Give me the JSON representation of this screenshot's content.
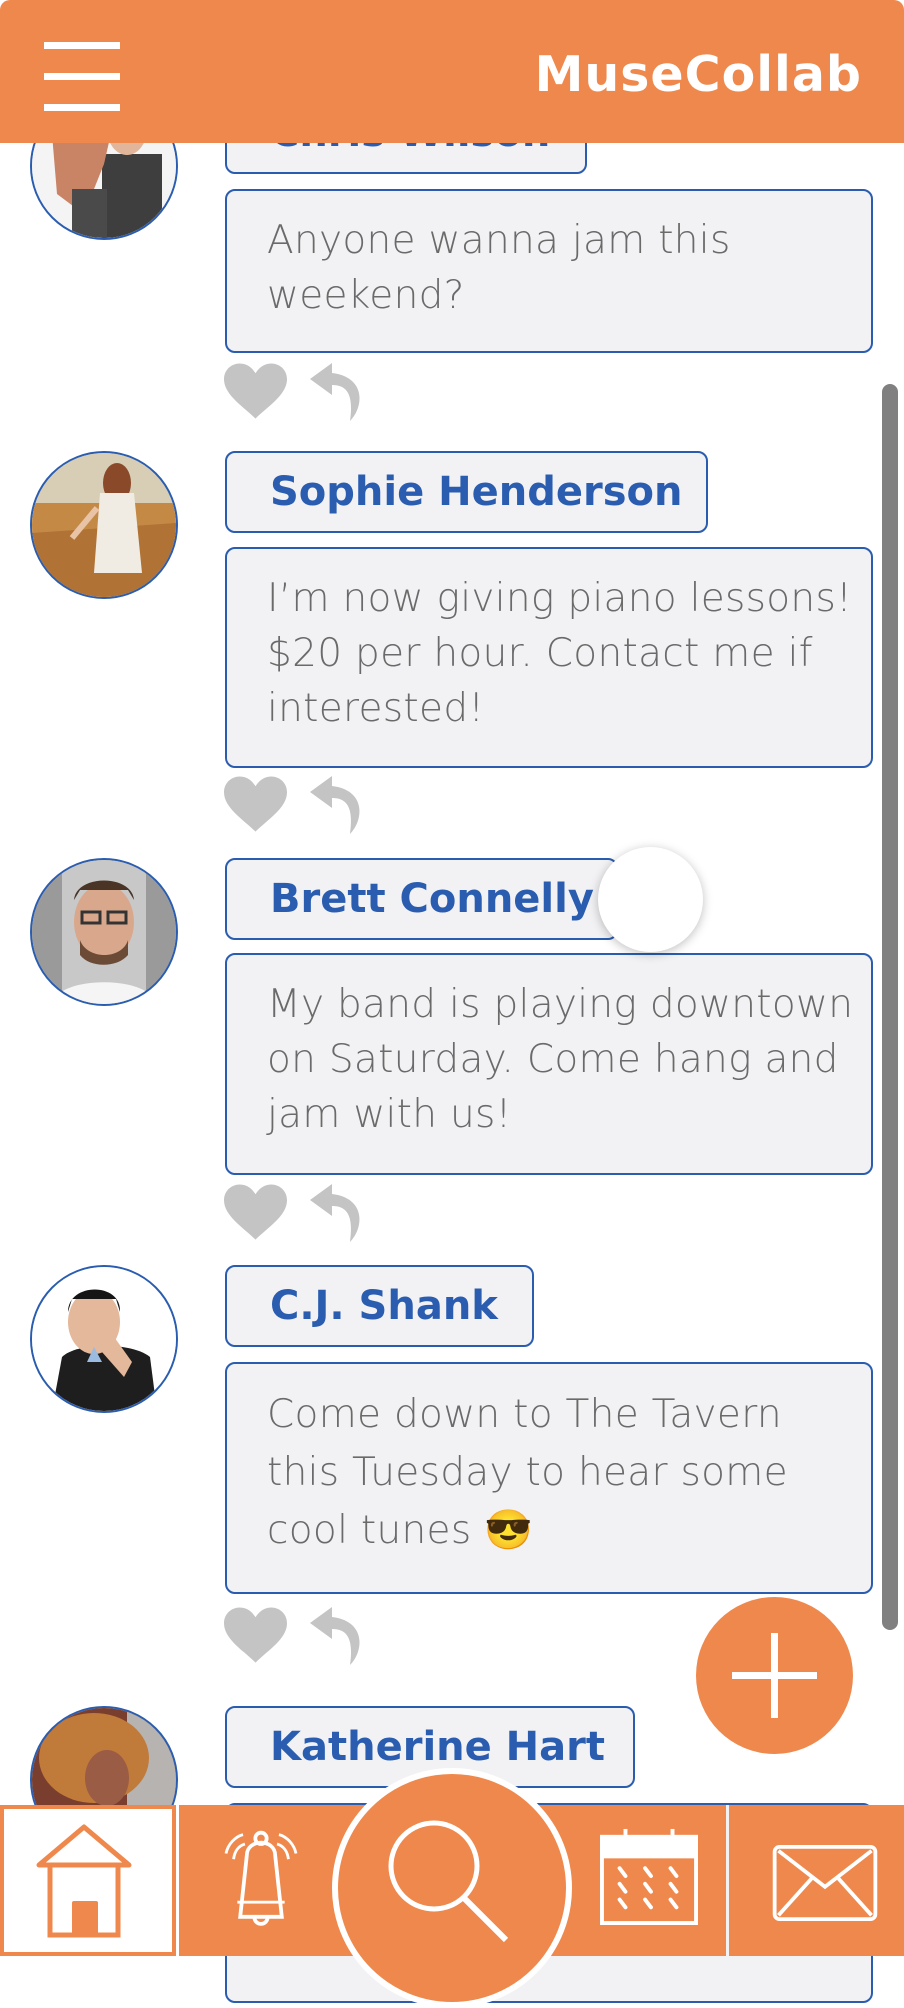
{
  "header": {
    "title": "MuseCollab",
    "menu_icon": "hamburger-menu-icon"
  },
  "colors": {
    "brand_orange": "#ef884c",
    "name_blue": "#2a5db0",
    "bubble_bg": "#f2f2f4",
    "message_text": "#6a6a6a",
    "action_gray": "#c4c4c4",
    "scrollbar_gray": "#808080"
  },
  "posts": [
    {
      "author": "Chris Wilson",
      "avatar": "avatar-chris-wilson",
      "message": "Anyone wanna jam this weekend?",
      "actions": [
        "like-heart-icon",
        "reply-arrow-icon"
      ]
    },
    {
      "author": "Sophie Henderson",
      "avatar": "avatar-sophie-henderson",
      "message": "I’m now giving piano lessons! $20 per hour. Contact me if interested!",
      "actions": [
        "like-heart-icon",
        "reply-arrow-icon"
      ]
    },
    {
      "author": "Brett Connelly",
      "avatar": "avatar-brett-connelly",
      "message": "My band is playing downtown on Saturday. Come hang and jam with us!",
      "actions": [
        "like-heart-icon",
        "reply-arrow-icon"
      ]
    },
    {
      "author": "C.J. Shank",
      "avatar": "avatar-cj-shank",
      "message": "Come down to The Tavern this Tuesday to hear some cool tunes 😎",
      "actions": [
        "like-heart-icon",
        "reply-arrow-icon"
      ]
    },
    {
      "author": "Katherine Hart",
      "avatar": "avatar-katherine-hart",
      "message": "",
      "actions": []
    }
  ],
  "fab": {
    "icon": "plus-icon",
    "label": "New post"
  },
  "bottom_nav": {
    "items": [
      {
        "id": "home",
        "icon": "home-icon",
        "active": true
      },
      {
        "id": "notifications",
        "icon": "bell-icon",
        "active": false
      },
      {
        "id": "search",
        "icon": "search-icon",
        "active": false
      },
      {
        "id": "calendar",
        "icon": "calendar-icon",
        "active": false
      },
      {
        "id": "messages",
        "icon": "mail-icon",
        "active": false
      }
    ]
  }
}
